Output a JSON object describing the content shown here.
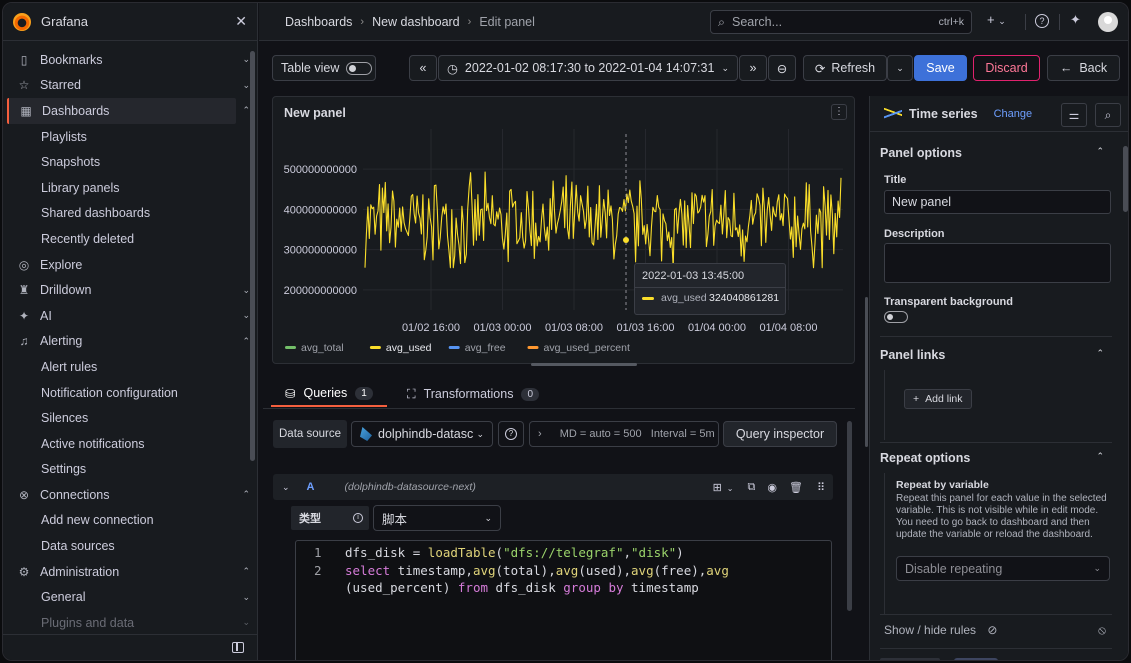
{
  "app": {
    "name": "Grafana"
  },
  "sidebar": {
    "items": [
      {
        "label": "Bookmarks",
        "icon": "bookmark-icon",
        "level": 0,
        "chev": "⌄"
      },
      {
        "label": "Starred",
        "icon": "star-icon",
        "level": 0,
        "chev": "⌄"
      },
      {
        "label": "Dashboards",
        "icon": "apps-icon",
        "level": 0,
        "chev": "⌃",
        "active": true
      },
      {
        "label": "Playlists",
        "level": 1
      },
      {
        "label": "Snapshots",
        "level": 1
      },
      {
        "label": "Library panels",
        "level": 1
      },
      {
        "label": "Shared dashboards",
        "level": 1
      },
      {
        "label": "Recently deleted",
        "level": 1
      },
      {
        "label": "Explore",
        "icon": "compass-icon",
        "level": 0
      },
      {
        "label": "Drilldown",
        "icon": "drilldown-icon",
        "level": 0,
        "chev": "⌄"
      },
      {
        "label": "AI",
        "icon": "ai-sparkle-icon",
        "level": 0,
        "chev": "⌄"
      },
      {
        "label": "Alerting",
        "icon": "bell-icon",
        "level": 0,
        "chev": "⌃"
      },
      {
        "label": "Alert rules",
        "level": 1
      },
      {
        "label": "Notification configuration",
        "level": 1
      },
      {
        "label": "Silences",
        "level": 1
      },
      {
        "label": "Active notifications",
        "level": 1
      },
      {
        "label": "Settings",
        "level": 1
      },
      {
        "label": "Connections",
        "icon": "link-icon",
        "level": 0,
        "chev": "⌃"
      },
      {
        "label": "Add new connection",
        "level": 1
      },
      {
        "label": "Data sources",
        "level": 1
      },
      {
        "label": "Administration",
        "icon": "cog-icon",
        "level": 0,
        "chev": "⌃"
      },
      {
        "label": "General",
        "level": 1,
        "chev": "⌄"
      },
      {
        "label": "Plugins and data",
        "level": 1,
        "chev": "⌄"
      }
    ]
  },
  "breadcrumb": {
    "items": [
      "Dashboards",
      "New dashboard",
      "Edit panel"
    ]
  },
  "search": {
    "placeholder": "Search...",
    "shortcut": "ctrl+k"
  },
  "toolbar": {
    "table_view": "Table view",
    "time_range": "2022-01-02 08:17:30 to 2022-01-04 14:07:31",
    "refresh": "Refresh",
    "save": "Save",
    "discard": "Discard",
    "back": "Back"
  },
  "panel": {
    "title": "New panel"
  },
  "chart_data": {
    "type": "line",
    "title": "New panel",
    "y_ticks": [
      "500000000000",
      "400000000000",
      "300000000000",
      "200000000000"
    ],
    "x_ticks": [
      "01/02 16:00",
      "01/03 00:00",
      "01/03 08:00",
      "01/03 16:00",
      "01/04 00:00",
      "01/04 08:00"
    ],
    "ylim": [
      150000000000,
      550000000000
    ],
    "series": [
      {
        "name": "avg_total",
        "color": "#73bf69"
      },
      {
        "name": "avg_used",
        "color": "#fade2a"
      },
      {
        "name": "avg_free",
        "color": "#5794f2"
      },
      {
        "name": "avg_used_percent",
        "color": "#ff9830"
      }
    ],
    "tooltip": {
      "time": "2022-01-03 13:45:00",
      "series": "avg_used",
      "value": "324040861281"
    },
    "grid": true,
    "legend": "bottom"
  },
  "query_tabs": [
    {
      "label": "Queries",
      "count": "1"
    },
    {
      "label": "Transformations",
      "count": "0"
    }
  ],
  "datasource": {
    "label": "Data source",
    "value": "dolphindb-datasc",
    "options_text": "MD = auto = 500   Interval = 5m",
    "inspector": "Query inspector"
  },
  "query": {
    "ref": "A",
    "source": "(dolphindb-datasource-next)",
    "type_label": "类型",
    "type_value": "脚本",
    "lines": [
      {
        "no": "1",
        "text": "dfs_disk = loadTable(\"dfs://telegraf\",\"disk\")"
      },
      {
        "no": "2",
        "text": "select timestamp,avg(total),avg(used),avg(free),avg"
      },
      {
        "no": "",
        "text": "(used_percent) from dfs_disk group by timestamp"
      }
    ]
  },
  "options": {
    "viz_name": "Time series",
    "change": "Change",
    "panel_options": "Panel options",
    "title_label": "Title",
    "title_value": "New panel",
    "description_label": "Description",
    "transparent_label": "Transparent background",
    "panel_links": "Panel links",
    "add_link": "Add link",
    "repeat_options": "Repeat options",
    "repeat_by": "Repeat by variable",
    "repeat_help": "Repeat this panel for each value in the selected variable. This is not visible while in edit mode. You need to go back to dashboard and then update the variable or reload the dashboard.",
    "repeat_value": "Disable repeating",
    "show_hide": "Show / hide rules"
  }
}
